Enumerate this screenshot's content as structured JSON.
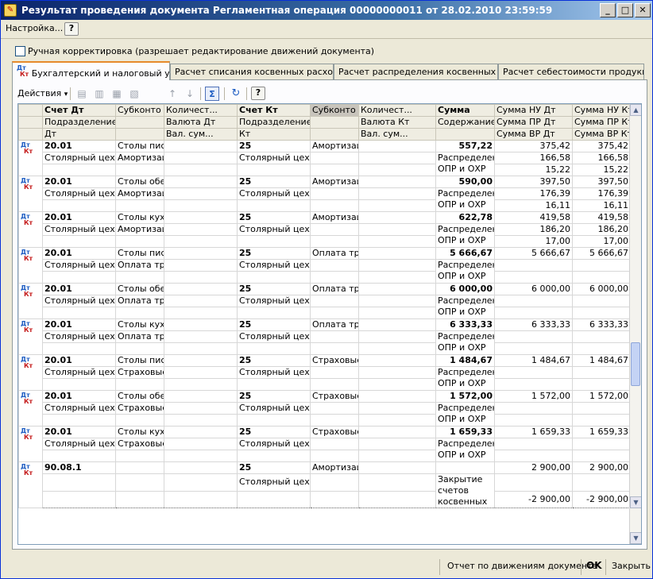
{
  "window": {
    "title": "Результат проведения документа Регламентная операция 00000000011 от 28.02.2010 23:59:59",
    "minimize": "_",
    "maximize": "□",
    "close": "✕"
  },
  "menu": {
    "settings": "Настройка...",
    "help": "?"
  },
  "manual_correction": {
    "label": "Ручная корректировка (разрешает редактирование движений документа)",
    "checked": false
  },
  "tabs": [
    {
      "label": "Бухгалтерский и налоговый учет",
      "active": true
    },
    {
      "label": "Расчет списания косвенных расходов"
    },
    {
      "label": "Расчет распределения косвенных р..."
    },
    {
      "label": "Расчет себестоимости продукции"
    }
  ],
  "icons": {
    "dt": "Дт",
    "kt": "Кт"
  },
  "toolbar": {
    "actions": "Действия",
    "actions_arrow": "▾",
    "sum_label": "Σ",
    "help": "?"
  },
  "columns": {
    "row1": [
      "Счет Дт",
      "Субконто Дт",
      "Количест...",
      "Счет Кт",
      "Субконто Кт",
      "Количест...",
      "Сумма",
      "Сумма НУ Дт",
      "Сумма НУ Кт"
    ],
    "row2": [
      "Подразделение",
      "",
      "Валюта Дт",
      "Подразделение",
      "",
      "Валюта Кт",
      "Содержание",
      "Сумма ПР Дт",
      "Сумма ПР Кт"
    ],
    "row3": [
      "Дт",
      "",
      "Вал. сум...",
      "Кт",
      "",
      "Вал. сум...",
      "",
      "Сумма ВР Дт",
      "Сумма ВР Кт"
    ]
  },
  "rows": [
    {
      "acc_dt": "20.01",
      "subconto_dt1": "Столы письмен...",
      "dept_dt": "Столярный цех",
      "subconto_dt2": "Амортизация",
      "acc_kt": "25",
      "dept_kt": "Столярный цех",
      "subconto_kt": "Амортизация",
      "sum": "557,22",
      "content": "Распределение ОПР и ОХР",
      "nu_dt": "375,42",
      "nu_kt": "375,42",
      "pr_dt": "166,58",
      "pr_kt": "166,58",
      "vr_dt": "15,22",
      "vr_kt": "15,22"
    },
    {
      "acc_dt": "20.01",
      "subconto_dt1": "Столы обеденн...",
      "dept_dt": "Столярный цех",
      "subconto_dt2": "Амортизация",
      "acc_kt": "25",
      "dept_kt": "Столярный цех",
      "subconto_kt": "Амортизация",
      "sum": "590,00",
      "content": "Распределение ОПР и ОХР",
      "nu_dt": "397,50",
      "nu_kt": "397,50",
      "pr_dt": "176,39",
      "pr_kt": "176,39",
      "vr_dt": "16,11",
      "vr_kt": "16,11"
    },
    {
      "acc_dt": "20.01",
      "subconto_dt1": "Столы кухонные",
      "dept_dt": "Столярный цех",
      "subconto_dt2": "Амортизация",
      "acc_kt": "25",
      "dept_kt": "Столярный цех",
      "subconto_kt": "Амортизация",
      "sum": "622,78",
      "content": "Распределение ОПР и ОХР",
      "nu_dt": "419,58",
      "nu_kt": "419,58",
      "pr_dt": "186,20",
      "pr_kt": "186,20",
      "vr_dt": "17,00",
      "vr_kt": "17,00"
    },
    {
      "acc_dt": "20.01",
      "subconto_dt1": "Столы письмен...",
      "dept_dt": "Столярный цех",
      "subconto_dt2": "Оплата труда",
      "acc_kt": "25",
      "dept_kt": "Столярный цех",
      "subconto_kt": "Оплата труда",
      "sum": "5 666,67",
      "content": "Распределение ОПР и ОХР",
      "nu_dt": "5 666,67",
      "nu_kt": "5 666,67",
      "pr_dt": "",
      "pr_kt": "",
      "vr_dt": "",
      "vr_kt": ""
    },
    {
      "acc_dt": "20.01",
      "subconto_dt1": "Столы обеденн...",
      "dept_dt": "Столярный цех",
      "subconto_dt2": "Оплата труда",
      "acc_kt": "25",
      "dept_kt": "Столярный цех",
      "subconto_kt": "Оплата труда",
      "sum": "6 000,00",
      "content": "Распределение ОПР и ОХР",
      "nu_dt": "6 000,00",
      "nu_kt": "6 000,00",
      "pr_dt": "",
      "pr_kt": "",
      "vr_dt": "",
      "vr_kt": ""
    },
    {
      "acc_dt": "20.01",
      "subconto_dt1": "Столы кухонные",
      "dept_dt": "Столярный цех",
      "subconto_dt2": "Оплата труда",
      "acc_kt": "25",
      "dept_kt": "Столярный цех",
      "subconto_kt": "Оплата труда",
      "sum": "6 333,33",
      "content": "Распределение ОПР и ОХР",
      "nu_dt": "6 333,33",
      "nu_kt": "6 333,33",
      "pr_dt": "",
      "pr_kt": "",
      "vr_dt": "",
      "vr_kt": ""
    },
    {
      "acc_dt": "20.01",
      "subconto_dt1": "Столы письмен...",
      "dept_dt": "Столярный цех",
      "subconto_dt2": "Страховые взн...",
      "acc_kt": "25",
      "dept_kt": "Столярный цех",
      "subconto_kt": "Страховые взн...",
      "sum": "1 484,67",
      "content": "Распределение ОПР и ОХР",
      "nu_dt": "1 484,67",
      "nu_kt": "1 484,67",
      "pr_dt": "",
      "pr_kt": "",
      "vr_dt": "",
      "vr_kt": ""
    },
    {
      "acc_dt": "20.01",
      "subconto_dt1": "Столы обеденн...",
      "dept_dt": "Столярный цех",
      "subconto_dt2": "Страховые взн...",
      "acc_kt": "25",
      "dept_kt": "Столярный цех",
      "subconto_kt": "Страховые взн...",
      "sum": "1 572,00",
      "content": "Распределение ОПР и ОХР",
      "nu_dt": "1 572,00",
      "nu_kt": "1 572,00",
      "pr_dt": "",
      "pr_kt": "",
      "vr_dt": "",
      "vr_kt": ""
    },
    {
      "acc_dt": "20.01",
      "subconto_dt1": "Столы кухонные",
      "dept_dt": "Столярный цех",
      "subconto_dt2": "Страховые взн...",
      "acc_kt": "25",
      "dept_kt": "Столярный цех",
      "subconto_kt": "Страховые взн...",
      "sum": "1 659,33",
      "content": "Распределение ОПР и ОХР",
      "nu_dt": "1 659,33",
      "nu_kt": "1 659,33",
      "pr_dt": "",
      "pr_kt": "",
      "vr_dt": "",
      "vr_kt": ""
    },
    {
      "acc_dt": "90.08.1",
      "subconto_dt1": "",
      "dept_dt": "",
      "subconto_dt2": "",
      "acc_kt": "25",
      "dept_kt": "Столярный цех",
      "subconto_kt": "Амортизацион...",
      "sum": "",
      "content": "Закрытие счетов косвенных",
      "nu_dt": "2 900,00",
      "nu_kt": "2 900,00",
      "pr_dt": "",
      "pr_kt": "",
      "vr_dt": "-2 900,00",
      "vr_kt": "-2 900,00"
    }
  ],
  "statusbar": {
    "report": "Отчет по движениям документа",
    "ok": "OK",
    "close": "Закрыть"
  }
}
